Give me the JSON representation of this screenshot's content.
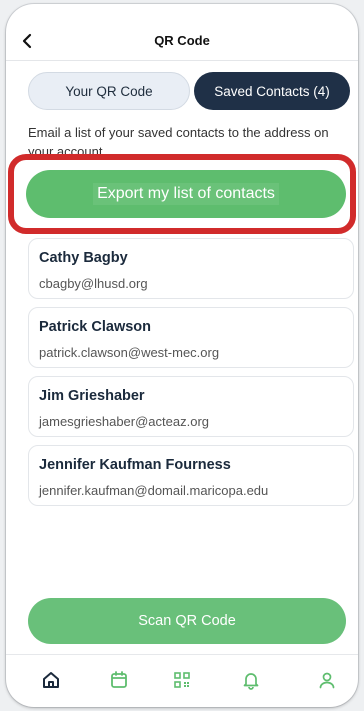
{
  "header": {
    "title": "QR Code",
    "back_icon": "chevron-left-icon"
  },
  "tabs": {
    "left_label": "Your QR Code",
    "right_label": "Saved Contacts (4)"
  },
  "description": "Email a list of your saved contacts to the address on your account.",
  "export_button": {
    "label": "Export my list of contacts"
  },
  "contacts": [
    {
      "name": "Cathy Bagby",
      "email": "cbagby@lhusd.org"
    },
    {
      "name": "Patrick Clawson",
      "email": "patrick.clawson@west-mec.org"
    },
    {
      "name": "Jim Grieshaber",
      "email": "jamesgrieshaber@acteaz.org"
    },
    {
      "name": "Jennifer Kaufman Fourness",
      "email": "jennifer.kaufman@domail.maricopa.edu"
    }
  ],
  "scan_button": {
    "label": "Scan QR Code"
  },
  "bottom_nav": [
    {
      "icon": "home-icon"
    },
    {
      "icon": "calendar-icon"
    },
    {
      "icon": "qr-code-icon"
    },
    {
      "icon": "bell-icon"
    },
    {
      "icon": "profile-icon"
    }
  ],
  "colors": {
    "accent_green": "#5ebd6e",
    "navy": "#1f3047",
    "highlight_red": "#d12b2b"
  }
}
